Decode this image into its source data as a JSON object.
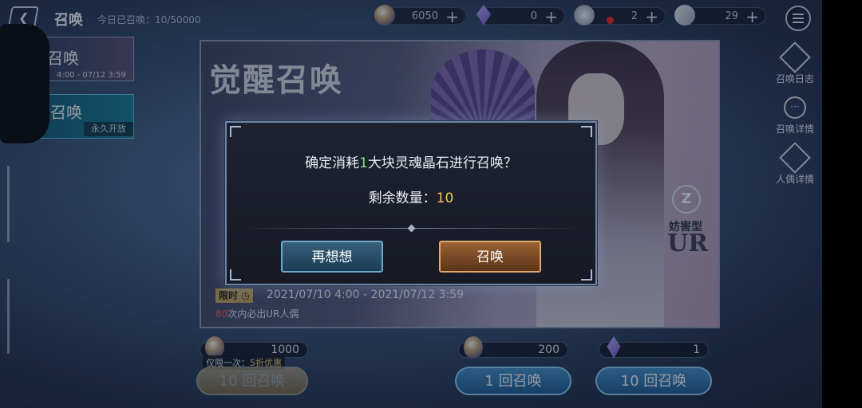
{
  "header": {
    "title": "召唤",
    "daily_summons": "今日已召唤：10/50000"
  },
  "resources": [
    {
      "icon": "soul-crystal-icon",
      "value": "6050"
    },
    {
      "icon": "crystal-icon",
      "value": "0"
    },
    {
      "icon": "ticket-icon",
      "value": "2"
    },
    {
      "icon": "feather-icon",
      "value": "29"
    }
  ],
  "side_tabs": {
    "limited_label": "召唤",
    "limited_dates": "4:00 - 07/12 3:59",
    "permanent_label": "召唤",
    "permanent_badge": "永久开放"
  },
  "right_menu": [
    {
      "icon": "summon-log-icon",
      "label": "召唤日志"
    },
    {
      "icon": "summon-details-icon",
      "label": "召唤详情"
    },
    {
      "icon": "doll-details-icon",
      "label": "人偶详情"
    }
  ],
  "banner": {
    "title": "觉醒召唤",
    "type": "妨害型",
    "rarity": "UR",
    "limit_tag": "限时",
    "dates": "2021/07/10 4:00 - 2021/07/12 3:59",
    "pity_count": "80",
    "pity_text": "次内必出UR人偶"
  },
  "costs": {
    "ten_discount": "1000",
    "single": "200",
    "ten_crystal": "1"
  },
  "deal": {
    "prefix": "仅限一次：",
    "highlight": "5折优惠"
  },
  "buttons": {
    "ten_discount": "10 回召唤",
    "single": "1 回召唤",
    "ten": "10 回召唤"
  },
  "dialog": {
    "question_prefix": "确定消耗",
    "question_amount": "1",
    "question_suffix": "大块灵魂晶石进行召唤？",
    "remaining_label": "剩余数量：",
    "remaining_value": "10",
    "cancel_label": "再想想",
    "confirm_label": "召唤"
  },
  "colors": {
    "accent_green": "#7fe07a",
    "accent_gold": "#f5c457",
    "pity_red": "#ff5a5a"
  }
}
